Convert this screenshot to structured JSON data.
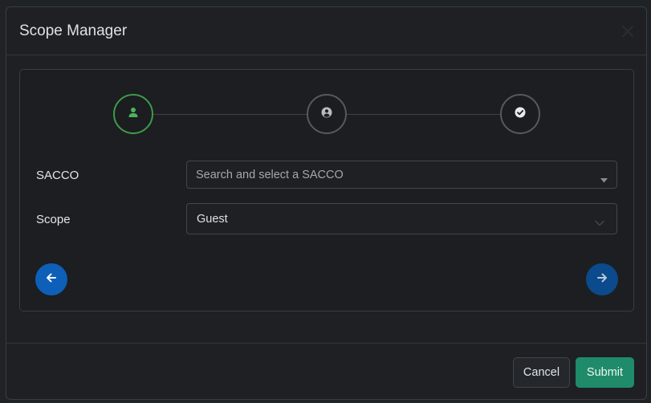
{
  "modal": {
    "title": "Scope Manager",
    "close_icon": "close-icon"
  },
  "stepper": {
    "steps": [
      {
        "icon": "user-icon",
        "state": "active"
      },
      {
        "icon": "user-circle-icon",
        "state": "inactive"
      },
      {
        "icon": "check-circle-icon",
        "state": "inactive"
      }
    ],
    "colors": {
      "active": "#3f9b48",
      "inactive": "#56595e"
    }
  },
  "form": {
    "sacco": {
      "label": "SACCO",
      "placeholder": "Search and select a SACCO"
    },
    "scope": {
      "label": "Scope",
      "value": "Guest"
    }
  },
  "navigation": {
    "back_icon": "arrow-left-icon",
    "next_icon": "arrow-right-icon",
    "color": "#0d5fb8"
  },
  "footer": {
    "cancel_label": "Cancel",
    "submit_label": "Submit",
    "submit_color": "#1f8b69"
  }
}
